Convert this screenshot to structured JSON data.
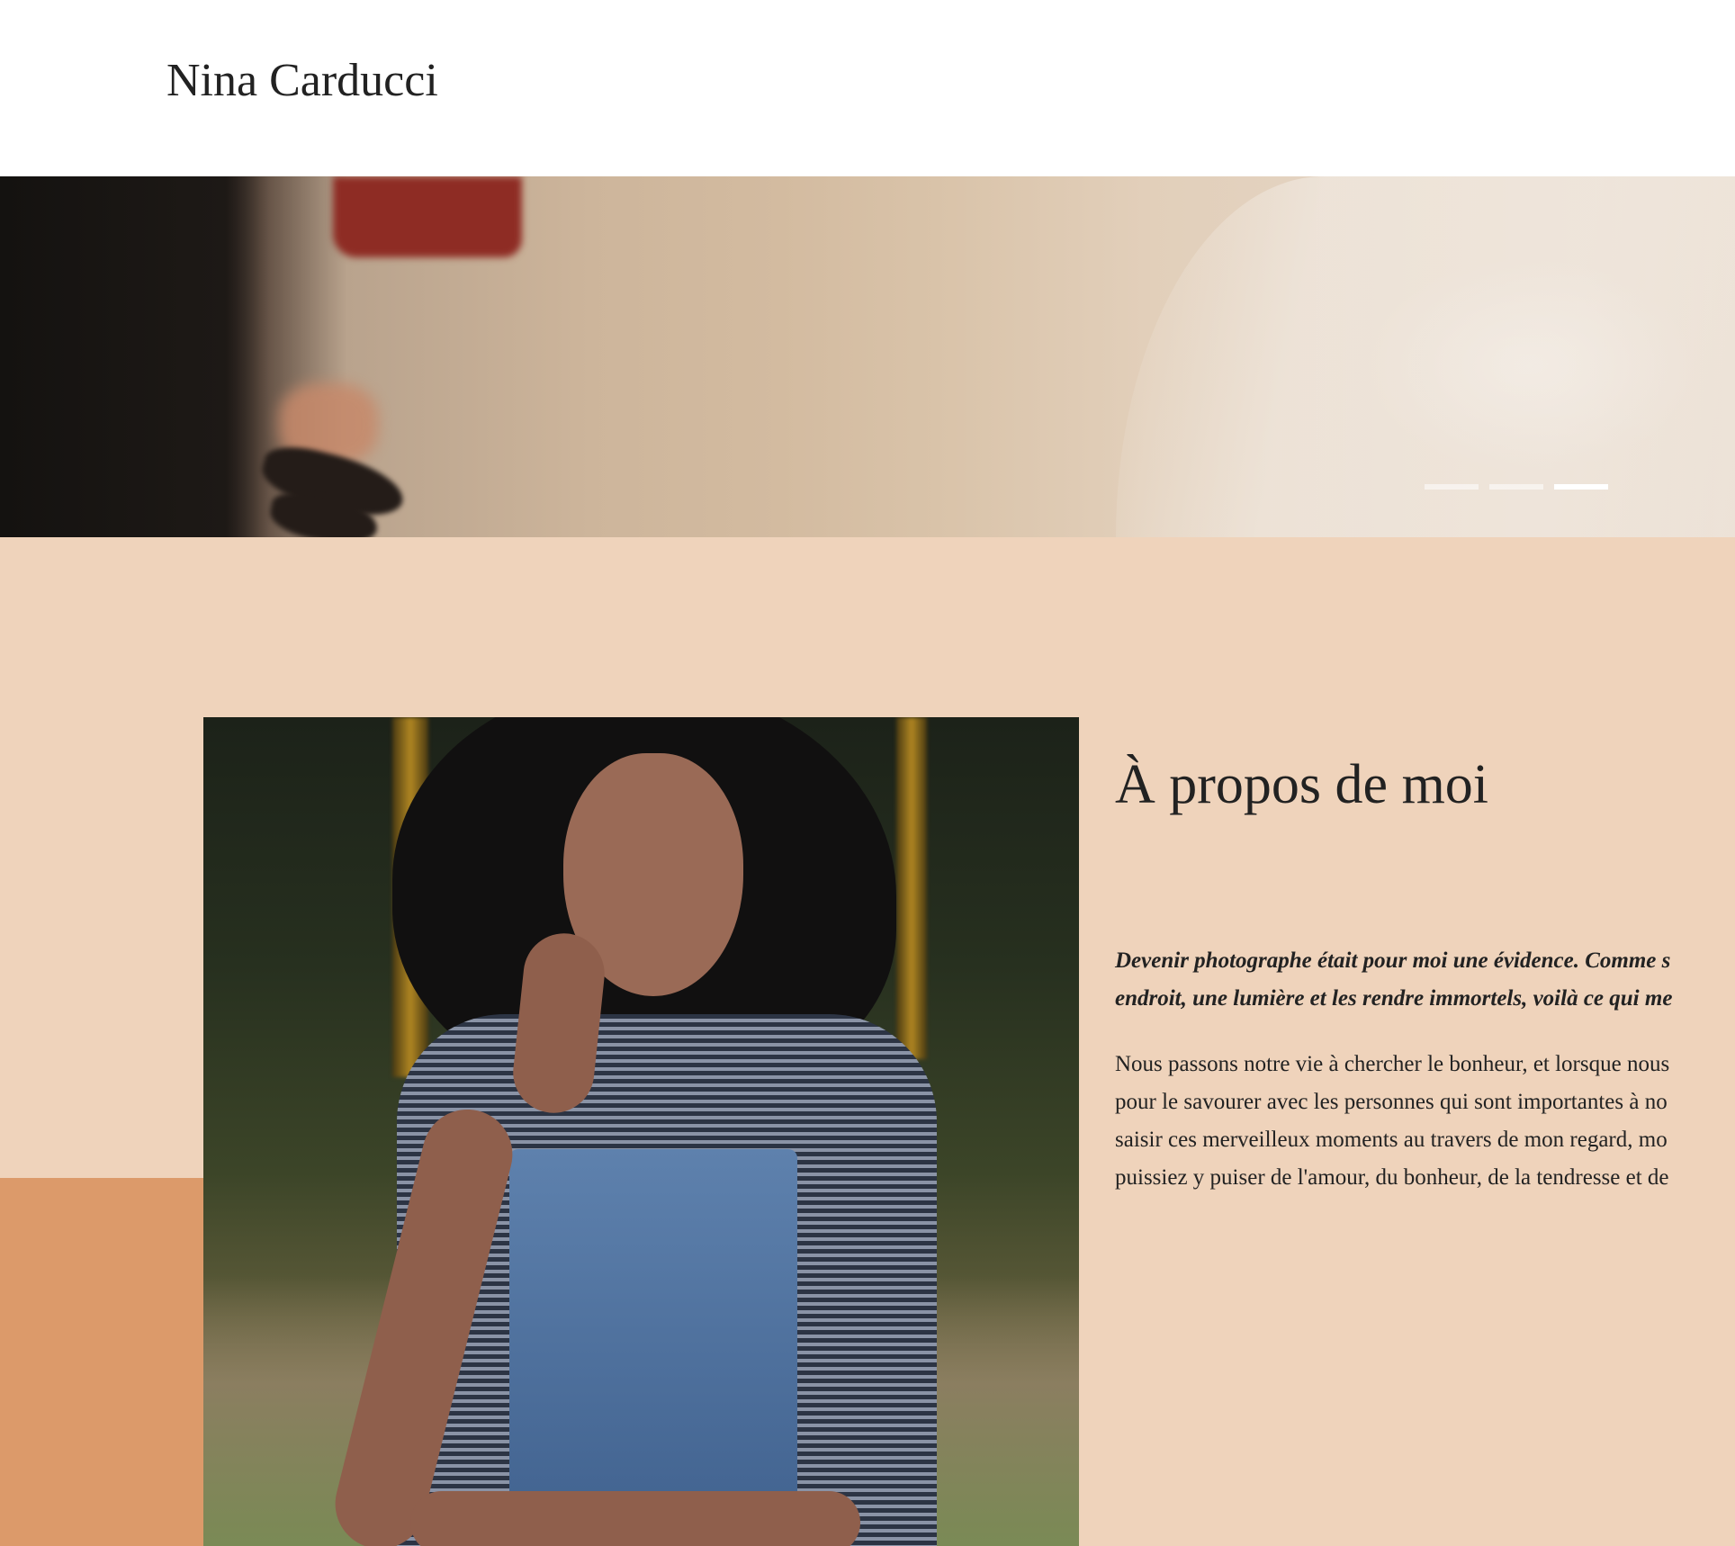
{
  "header": {
    "site_title": "Nina Carducci"
  },
  "hero": {
    "slides_total": 3,
    "active_slide_index": 3,
    "indicators": [
      {
        "label": "slide-1",
        "active": false
      },
      {
        "label": "slide-2",
        "active": false
      },
      {
        "label": "slide-3",
        "active": true
      }
    ]
  },
  "about": {
    "heading": "À propos de moi",
    "lead_lines": [
      "Devenir photographe était pour moi une évidence. Comme s",
      "endroit, une lumière et les rendre immortels, voilà ce qui me"
    ],
    "body_lines": [
      "Nous passons notre vie à chercher le bonheur, et lorsque nous",
      "pour le savourer avec les personnes qui sont importantes à no",
      "saisir ces merveilleux moments au travers de mon regard, mo",
      "puissiez y puiser de l'amour, du bonheur, de la tendresse et de"
    ]
  },
  "colors": {
    "about_background": "#efd3bb",
    "accent_block": "#dc9a6a",
    "text": "#222222",
    "header_background": "#ffffff"
  }
}
